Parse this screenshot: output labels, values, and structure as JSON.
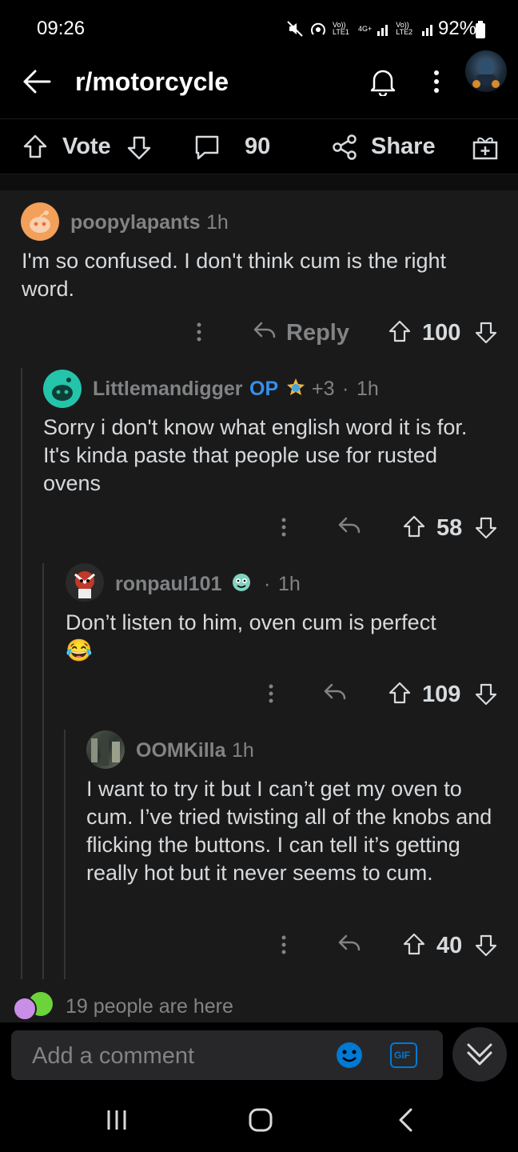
{
  "status_bar": {
    "time": "09:26",
    "sim1_label": "Vo)) LTE1",
    "network_label": "4G+",
    "sim2_label": "Vo)) LTE2",
    "battery": "92%"
  },
  "header": {
    "subreddit": "r/motorcycle"
  },
  "action_bar": {
    "vote_label": "Vote",
    "comment_count": "90",
    "share_label": "Share"
  },
  "comments": [
    {
      "username": "poopylapants",
      "flair": "",
      "time": "1h",
      "body": "I'm so confused. I don't think cum is the right word.",
      "reply_label": "Reply",
      "score": "100"
    },
    {
      "username": "Littlemandigger",
      "op_label": "OP",
      "karma": "+3",
      "time": "1h",
      "body": "Sorry i don't know what english word it is for. It's kinda paste that people use for rusted ovens",
      "score": "58"
    },
    {
      "username": "ronpaul101",
      "time": "1h",
      "body": "Don’t listen to him, oven cum is perfect",
      "emoji": "😂",
      "score": "109"
    },
    {
      "username": "OOMKilla",
      "time": "1h",
      "body": "I want to try it but I can’t get my oven to cum. I’ve tried twisting all of the knobs and flicking the buttons. I can tell it’s getting really hot but it never seems to cum.",
      "score": "40"
    }
  ],
  "presence": {
    "text": "19 people are here"
  },
  "composer": {
    "placeholder": "Add a comment",
    "gif_label": "GIF"
  },
  "colors": {
    "background": "#1a1a1b",
    "text": "#d7dadc",
    "muted": "#818384",
    "op_blue": "#3690ea",
    "accent_blue": "#0079d3"
  }
}
